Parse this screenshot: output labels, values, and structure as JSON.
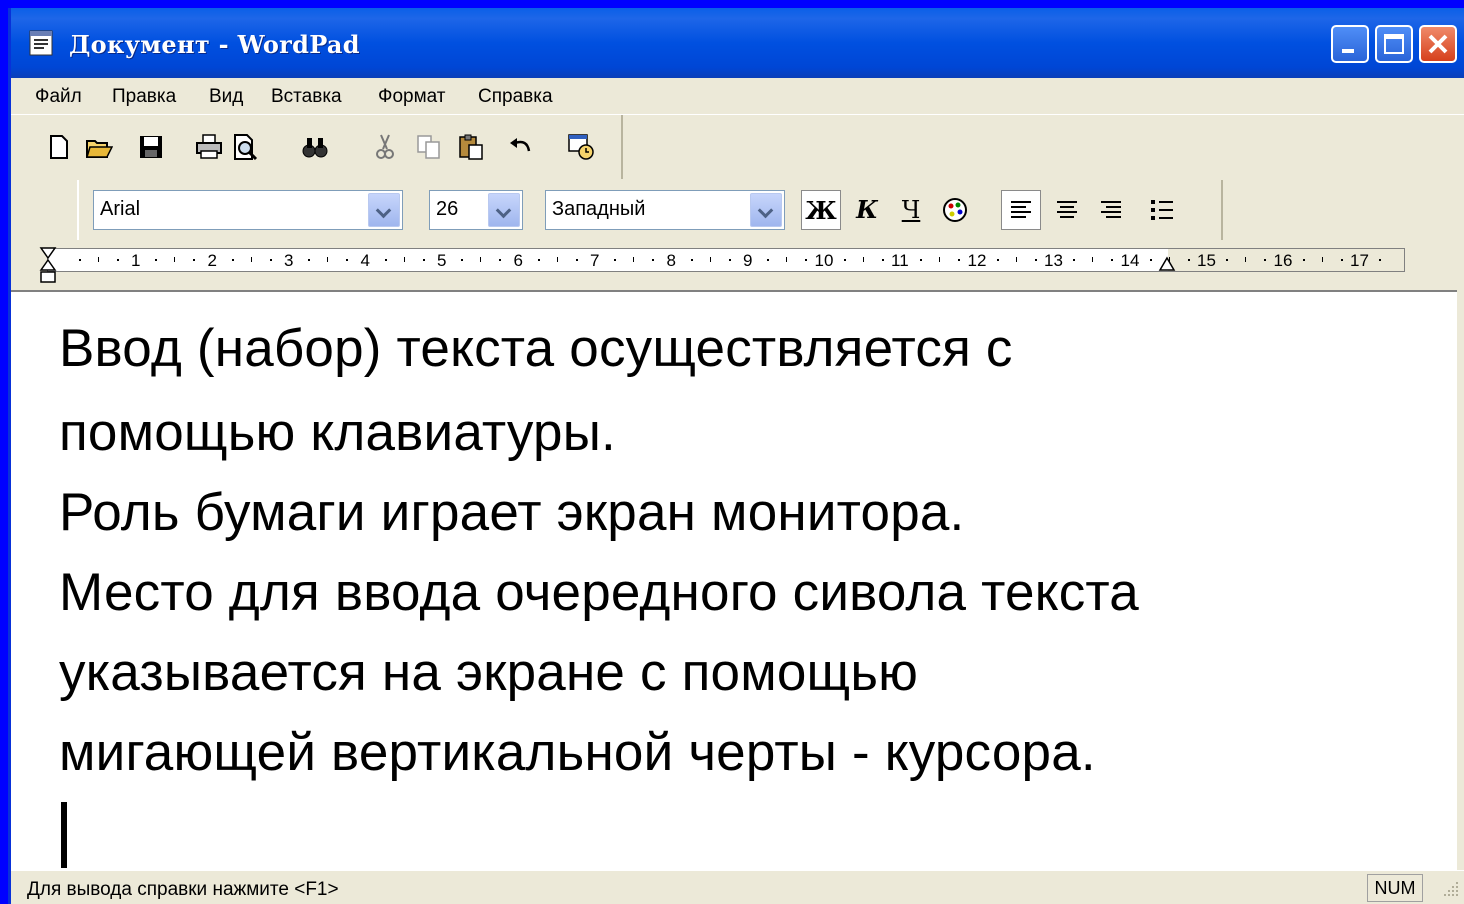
{
  "window": {
    "title": "Документ - WordPad"
  },
  "menu": [
    "Файл",
    "Правка",
    "Вид",
    "Вставка",
    "Формат",
    "Справка"
  ],
  "toolbar_icons": [
    "new-icon",
    "open-icon",
    "save-icon",
    "print-icon",
    "print-preview-icon",
    "find-icon",
    "cut-icon",
    "copy-icon",
    "paste-icon",
    "undo-icon",
    "datetime-icon"
  ],
  "format": {
    "font": "Arial",
    "size": "26",
    "script": "Западный",
    "bold": "Ж",
    "italic": "К",
    "underline": "Ч"
  },
  "ruler": [
    "1",
    "2",
    "3",
    "4",
    "5",
    "6",
    "7",
    "8",
    "9",
    "10",
    "11",
    "12",
    "13",
    "14",
    "15",
    "16",
    "17"
  ],
  "document": {
    "lines": [
      "Ввод (набор) текста осуществляется с",
      "помощью клавиатуры.",
      "Роль бумаги играет экран монитора.",
      "Место для ввода очередного сивола текста",
      "указывается на экране с помощью",
      "мигающей вертикальной черты - курсора."
    ]
  },
  "status": {
    "help": "Для вывода справки нажмите <F1>",
    "num": "NUM"
  },
  "colors": {
    "desktop": "#0000ff",
    "title_bar": "#0054e3",
    "chrome": "#ece9d8"
  }
}
